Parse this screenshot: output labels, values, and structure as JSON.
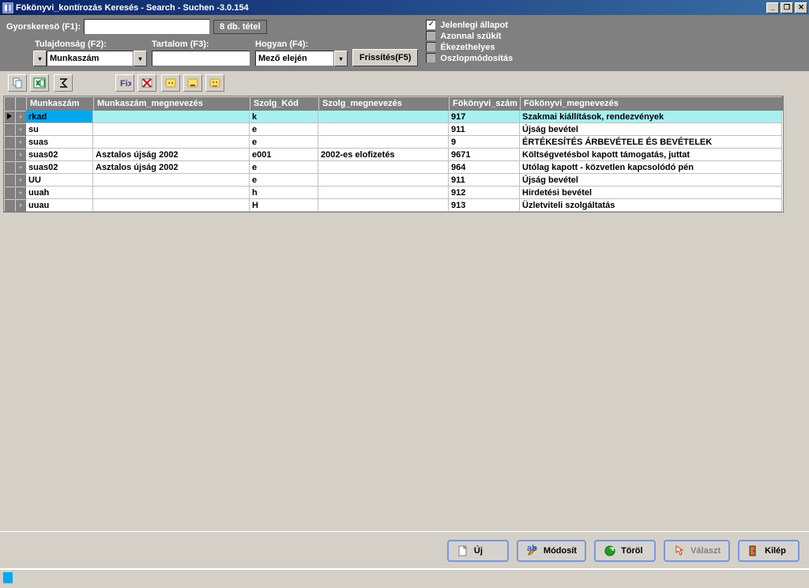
{
  "window": {
    "title": "Fökönyvi_kontírozás Keresés - Search - Suchen -3.0.154"
  },
  "search": {
    "quick_label": "Gyorskeresö (F1):",
    "quick_value": "",
    "count": "8 db. tétel",
    "prop_label": "Tulajdonság (F2):",
    "prop_value": "Munkaszám",
    "content_label": "Tartalom (F3):",
    "content_value": "",
    "how_label": "Hogyan (F4):",
    "how_value": "Mező elején",
    "refresh": "Frissítés(F5)"
  },
  "checks": {
    "current_state": "Jelenlegi állapot",
    "auto_refine": "Azonnal szükít",
    "accent": "Ékezethelyes",
    "column_resize": "Oszlopmódosítás"
  },
  "columns": [
    "Munkaszám",
    "Munkaszám_megnevezés",
    "Szolg_Kód",
    "Szolg_megnevezés",
    "Fökönyvi_szám",
    "Fökönyvi_megnevezés"
  ],
  "rows": [
    {
      "c0": "rkad",
      "c1": "",
      "c2": "k",
      "c3": "",
      "c4": "917",
      "c5": "Szakmai kiállítások, rendezvények",
      "selected": true
    },
    {
      "c0": "su",
      "c1": "",
      "c2": "e",
      "c3": "",
      "c4": "911",
      "c5": "Újság bevétel"
    },
    {
      "c0": "suas",
      "c1": "",
      "c2": "e",
      "c3": "",
      "c4": "9",
      "c5": "ÉRTÉKESÍTÉS ÁRBEVÉTELE ÉS BEVÉTELEK"
    },
    {
      "c0": "suas02",
      "c1": "Asztalos újság 2002",
      "c2": "e001",
      "c3": "2002-es elofizetés",
      "c4": "9671",
      "c5": "Költségvetésbol kapott támogatás, juttat"
    },
    {
      "c0": "suas02",
      "c1": "Asztalos újság 2002",
      "c2": "e",
      "c3": "",
      "c4": "964",
      "c5": "Utólag kapott - közvetlen kapcsolódó pén"
    },
    {
      "c0": "UU",
      "c1": "",
      "c2": "e",
      "c3": "",
      "c4": "911",
      "c5": "Újság bevétel"
    },
    {
      "c0": "uuah",
      "c1": "",
      "c2": "h",
      "c3": "",
      "c4": "912",
      "c5": "Hirdetési bevétel"
    },
    {
      "c0": "uuau",
      "c1": "",
      "c2": "H",
      "c3": "",
      "c4": "913",
      "c5": "Üzletviteli szolgáltatás"
    }
  ],
  "actions": {
    "new": "Új",
    "modify": "Módosít",
    "delete": "Töröl",
    "select": "Választ",
    "exit": "Kilép"
  }
}
